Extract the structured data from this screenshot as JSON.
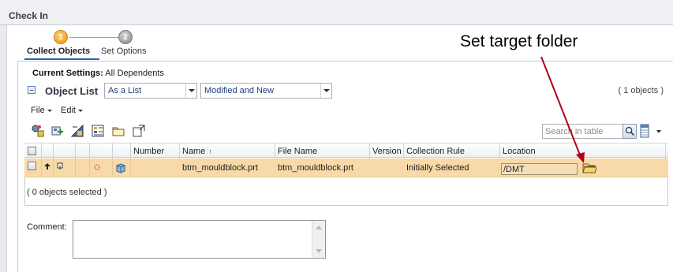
{
  "window": {
    "title": "Check In"
  },
  "steps": [
    {
      "number": "1",
      "label": "Collect Objects"
    },
    {
      "number": "2",
      "label": "Set Options"
    }
  ],
  "current_settings": {
    "label": "Current Settings:",
    "value": "All Dependents"
  },
  "object_list": {
    "title": "Object List",
    "view_select": "As a List",
    "filter_select": "Modified and New",
    "count": "( 1 objects )"
  },
  "menus": {
    "file": "File",
    "edit": "Edit"
  },
  "search": {
    "placeholder": "Search in table"
  },
  "table": {
    "columns": {
      "number": "Number",
      "name": "Name",
      "name_sort": "↑",
      "file_name": "File Name",
      "version": "Version",
      "collection_rule": "Collection Rule",
      "location": "Location"
    },
    "rows": [
      {
        "number": "",
        "name": "btm_mouldblock.prt",
        "file_name": "btm_mouldblock.prt",
        "version": "",
        "collection_rule": "Initially Selected",
        "location": "/DMT"
      }
    ],
    "selected_count": "( 0 objects selected )"
  },
  "comment": {
    "label": "Comment:",
    "value": ""
  },
  "annotation": {
    "text": "Set target folder"
  },
  "icons": {
    "collapse": "collapse-icon",
    "search": "search-icon",
    "columns": "columns-icon",
    "folder": "folder-icon"
  },
  "colors": {
    "row_highlight": "#f8d9a8",
    "step_active": "#f2a72b",
    "step_inactive": "#9c9c9c",
    "annotation_arrow": "#b0001a"
  }
}
